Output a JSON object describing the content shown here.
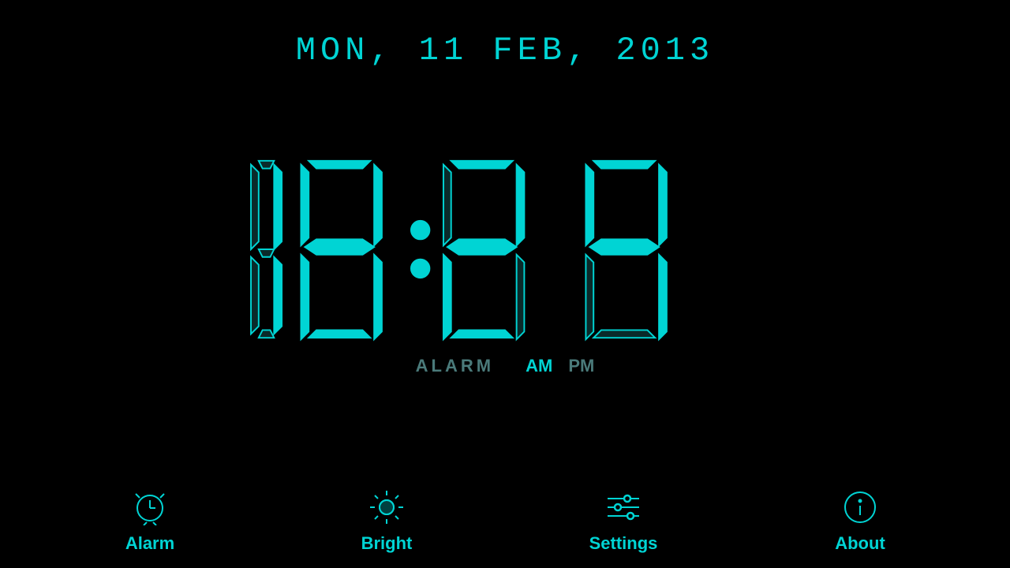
{
  "date": {
    "display": "MON,  11 FEB,  2013"
  },
  "clock": {
    "time": "18:29",
    "hour": "18",
    "minute": "29",
    "am_label": "AM",
    "pm_label": "PM",
    "alarm_label": "ALARM",
    "am_active": true
  },
  "nav": {
    "items": [
      {
        "id": "alarm",
        "label": "Alarm",
        "icon": "alarm-clock-icon"
      },
      {
        "id": "bright",
        "label": "Bright",
        "icon": "brightness-icon"
      },
      {
        "id": "settings",
        "label": "Settings",
        "icon": "settings-icon"
      },
      {
        "id": "about",
        "label": "About",
        "icon": "info-icon"
      }
    ]
  },
  "colors": {
    "primary": "#00d4d4",
    "inactive": "#4a7a7a",
    "background": "#000000"
  }
}
